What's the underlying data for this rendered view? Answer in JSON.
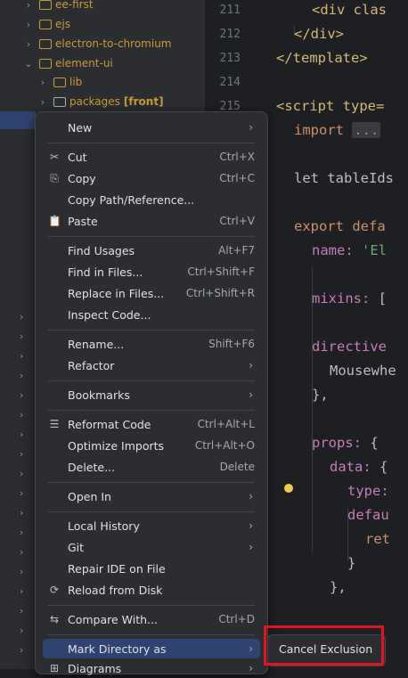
{
  "tree": {
    "items": [
      {
        "label": "ee-first"
      },
      {
        "label": "ejs"
      },
      {
        "label": "electron-to-chromium"
      },
      {
        "label": "element-ui"
      },
      {
        "label": "lib"
      },
      {
        "label": "packages",
        "suffix": "[front]"
      }
    ]
  },
  "editor": {
    "line_numbers": [
      "211",
      "212",
      "213",
      "214",
      "215"
    ],
    "lines": {
      "l211": "<div clas",
      "l212": "</div>",
      "l213": "</template>",
      "l215": "<script type=",
      "l216_kw": "import",
      "l216_fold": "...",
      "l217": "let tableIds",
      "l218_kw": "export defa",
      "l219_prop": "name:",
      "l219_str": " 'El",
      "l220_prop": "mixins:",
      "l220_rest": " [",
      "l221_prop": "directive",
      "l222": "Mousewhe",
      "l223": "},",
      "l224_prop": "props:",
      "l224_rest": " {",
      "l225_prop": "data:",
      "l225_rest": " {",
      "l226_prop": "type:",
      "l227_prop": "defau",
      "l228_kw": "ret",
      "l229": "}",
      "l230": "},"
    }
  },
  "menu": {
    "new": "New",
    "cut": "Cut",
    "cut_sc": "Ctrl+X",
    "copy": "Copy",
    "copy_sc": "Ctrl+C",
    "copy_path": "Copy Path/Reference...",
    "paste": "Paste",
    "paste_sc": "Ctrl+V",
    "find_usages": "Find Usages",
    "find_usages_sc": "Alt+F7",
    "find_in_files": "Find in Files...",
    "find_in_files_sc": "Ctrl+Shift+F",
    "replace_in_files": "Replace in Files...",
    "replace_in_files_sc": "Ctrl+Shift+R",
    "inspect_code": "Inspect Code...",
    "rename": "Rename...",
    "rename_sc": "Shift+F6",
    "refactor": "Refactor",
    "bookmarks": "Bookmarks",
    "reformat_code": "Reformat Code",
    "reformat_code_sc": "Ctrl+Alt+L",
    "optimize_imports": "Optimize Imports",
    "optimize_imports_sc": "Ctrl+Alt+O",
    "delete": "Delete...",
    "delete_sc": "Delete",
    "open_in": "Open In",
    "local_history": "Local History",
    "git": "Git",
    "repair_ide": "Repair IDE on File",
    "reload_from_disk": "Reload from Disk",
    "compare_with": "Compare With...",
    "compare_with_sc": "Ctrl+D",
    "mark_directory_as": "Mark Directory as",
    "diagrams": "Diagrams"
  },
  "submenu": {
    "cancel_exclusion": "Cancel Exclusion"
  },
  "colors": {
    "excluded": "#c99a3a",
    "selection": "#2e436e",
    "annotation": "#e0141e"
  }
}
